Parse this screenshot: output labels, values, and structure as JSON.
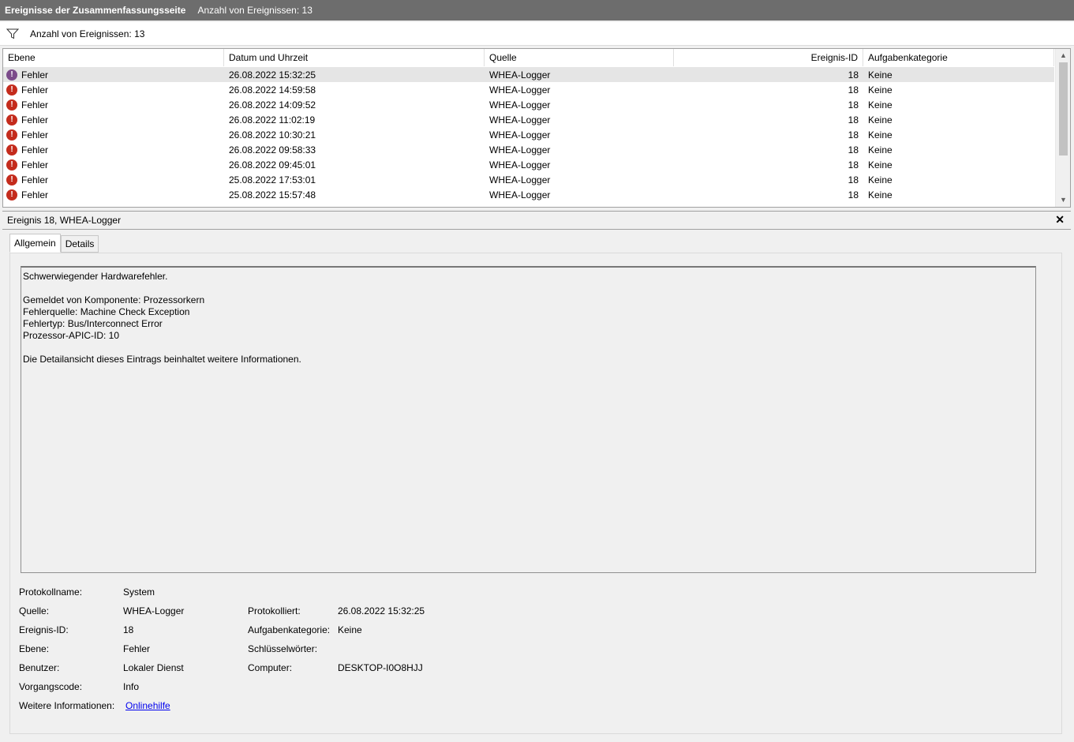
{
  "titlebar": {
    "title": "Ereignisse der Zusammenfassungsseite",
    "count": "Anzahl von Ereignissen: 13"
  },
  "filterbar": {
    "count": "Anzahl von Ereignissen: 13",
    "icon": "filter-icon"
  },
  "columns": {
    "level": "Ebene",
    "datetime": "Datum und Uhrzeit",
    "source": "Quelle",
    "event_id": "Ereignis-ID",
    "category": "Aufgabenkategorie"
  },
  "rows": [
    {
      "level": "Fehler",
      "datetime": "26.08.2022 15:32:25",
      "source": "WHEA-Logger",
      "event_id": "18",
      "category": "Keine",
      "selected": true
    },
    {
      "level": "Fehler",
      "datetime": "26.08.2022 14:59:58",
      "source": "WHEA-Logger",
      "event_id": "18",
      "category": "Keine"
    },
    {
      "level": "Fehler",
      "datetime": "26.08.2022 14:09:52",
      "source": "WHEA-Logger",
      "event_id": "18",
      "category": "Keine"
    },
    {
      "level": "Fehler",
      "datetime": "26.08.2022 11:02:19",
      "source": "WHEA-Logger",
      "event_id": "18",
      "category": "Keine"
    },
    {
      "level": "Fehler",
      "datetime": "26.08.2022 10:30:21",
      "source": "WHEA-Logger",
      "event_id": "18",
      "category": "Keine"
    },
    {
      "level": "Fehler",
      "datetime": "26.08.2022 09:58:33",
      "source": "WHEA-Logger",
      "event_id": "18",
      "category": "Keine"
    },
    {
      "level": "Fehler",
      "datetime": "26.08.2022 09:45:01",
      "source": "WHEA-Logger",
      "event_id": "18",
      "category": "Keine"
    },
    {
      "level": "Fehler",
      "datetime": "25.08.2022 17:53:01",
      "source": "WHEA-Logger",
      "event_id": "18",
      "category": "Keine"
    },
    {
      "level": "Fehler",
      "datetime": "25.08.2022 15:57:48",
      "source": "WHEA-Logger",
      "event_id": "18",
      "category": "Keine"
    }
  ],
  "detail": {
    "header": "Ereignis 18, WHEA-Logger",
    "close": "✕",
    "tabs": {
      "general": "Allgemein",
      "details": "Details"
    },
    "description": {
      "line1": "Schwerwiegender Hardwarefehler.",
      "line2": "",
      "line3": "Gemeldet von Komponente: Prozessorkern",
      "line4": "Fehlerquelle: Machine Check Exception",
      "line5": "Fehlertyp: Bus/Interconnect Error",
      "line6": "Prozessor-APIC-ID: 10",
      "line7": "",
      "line8": "Die Detailansicht dieses Eintrags beinhaltet weitere Informationen."
    },
    "fields": {
      "log_name_label": "Protokollname:",
      "log_name": "System",
      "source_label": "Quelle:",
      "source": "WHEA-Logger",
      "logged_label": "Protokolliert:",
      "logged": "26.08.2022 15:32:25",
      "event_id_label": "Ereignis-ID:",
      "event_id": "18",
      "category_label": "Aufgabenkategorie:",
      "category": "Keine",
      "level_label": "Ebene:",
      "level": "Fehler",
      "keywords_label": "Schlüsselwörter:",
      "keywords": "",
      "user_label": "Benutzer:",
      "user": "Lokaler Dienst",
      "computer_label": "Computer:",
      "computer": "DESKTOP-I0O8HJJ",
      "opcode_label": "Vorgangscode:",
      "opcode": "Info",
      "more_info_label": "Weitere Informationen:",
      "more_info_link": "Onlinehilfe"
    }
  },
  "colors": {
    "titlebar": "#6d6d6d",
    "error_icon": "#c42b1c",
    "link": "#0000ee"
  }
}
